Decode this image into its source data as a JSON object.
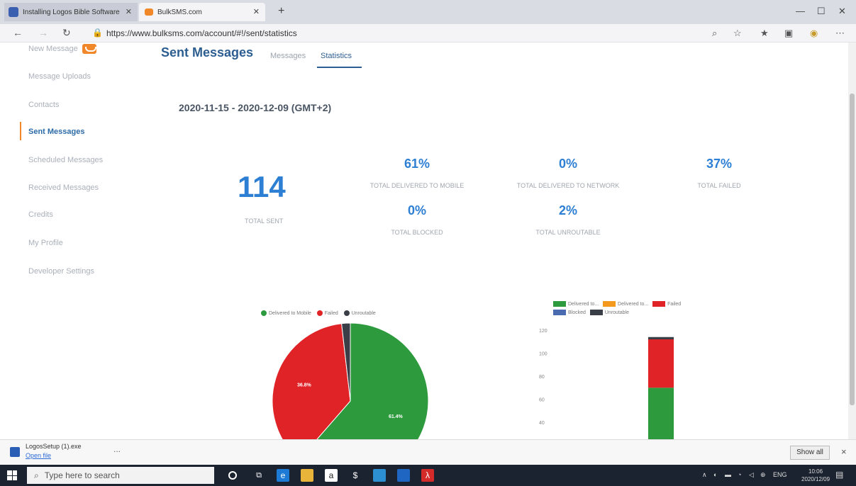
{
  "browser": {
    "tabs": [
      {
        "title": "Installing Logos Bible Software",
        "active": false
      },
      {
        "title": "BulkSMS.com",
        "active": true
      }
    ],
    "url": "https://www.bulksms.com/account/#!/sent/statistics"
  },
  "sidebar": {
    "items": [
      {
        "label": "New Message"
      },
      {
        "label": "Message Uploads"
      },
      {
        "label": "Contacts"
      },
      {
        "label": "Sent Messages",
        "active": true
      },
      {
        "label": "Scheduled Messages"
      },
      {
        "label": "Received Messages"
      },
      {
        "label": "Credits"
      },
      {
        "label": "My Profile"
      },
      {
        "label": "Developer Settings"
      }
    ]
  },
  "main": {
    "title": "Sent Messages",
    "tabs": [
      {
        "label": "Messages",
        "active": false
      },
      {
        "label": "Statistics",
        "active": true
      }
    ],
    "date_range": "2020-11-15 - 2020-12-09 (GMT+2)",
    "total_sent": {
      "value": "114",
      "label": "TOTAL SENT"
    },
    "stats": [
      {
        "value": "61%",
        "label": "TOTAL DELIVERED TO MOBILE"
      },
      {
        "value": "0%",
        "label": "TOTAL DELIVERED TO NETWORK"
      },
      {
        "value": "37%",
        "label": "TOTAL FAILED"
      },
      {
        "value": "0%",
        "label": "TOTAL BLOCKED"
      },
      {
        "value": "2%",
        "label": "TOTAL UNROUTABLE"
      }
    ]
  },
  "chart_data": [
    {
      "type": "pie",
      "legend": [
        "Delivered to Mobile",
        "Failed",
        "Unroutable"
      ],
      "values": [
        61.4,
        36.8,
        1.8
      ],
      "data_labels": [
        "61.4%",
        "36.8%",
        ""
      ],
      "colors": [
        "#2e9a3e",
        "#e02327",
        "#3a3f47"
      ],
      "legend_position": "top"
    },
    {
      "type": "bar",
      "stacked": true,
      "legend": [
        "Delivered to...",
        "Delivered to...",
        "Failed",
        "Blocked",
        "Unroutable"
      ],
      "colors": [
        "#2e9a3e",
        "#f39a1e",
        "#e02327",
        "#4a6bb0",
        "#3a3f47"
      ],
      "series": [
        {
          "name": "Delivered to...",
          "values": [
            70
          ]
        },
        {
          "name": "Delivered to...",
          "values": [
            0
          ]
        },
        {
          "name": "Failed",
          "values": [
            42
          ]
        },
        {
          "name": "Blocked",
          "values": [
            0
          ]
        },
        {
          "name": "Unroutable",
          "values": [
            2
          ]
        }
      ],
      "yticks": [
        "120",
        "100",
        "80",
        "60",
        "40"
      ],
      "ylim": [
        0,
        120
      ],
      "legend_position": "top"
    }
  ],
  "downloads": {
    "file_name": "LogosSetup (1).exe",
    "open_label": "Open file",
    "more": "...",
    "show_all": "Show all",
    "close": "×"
  },
  "taskbar": {
    "search_placeholder": "Type here to search",
    "lang": "ENG",
    "time": "10:06",
    "date": "2020/12/09"
  }
}
